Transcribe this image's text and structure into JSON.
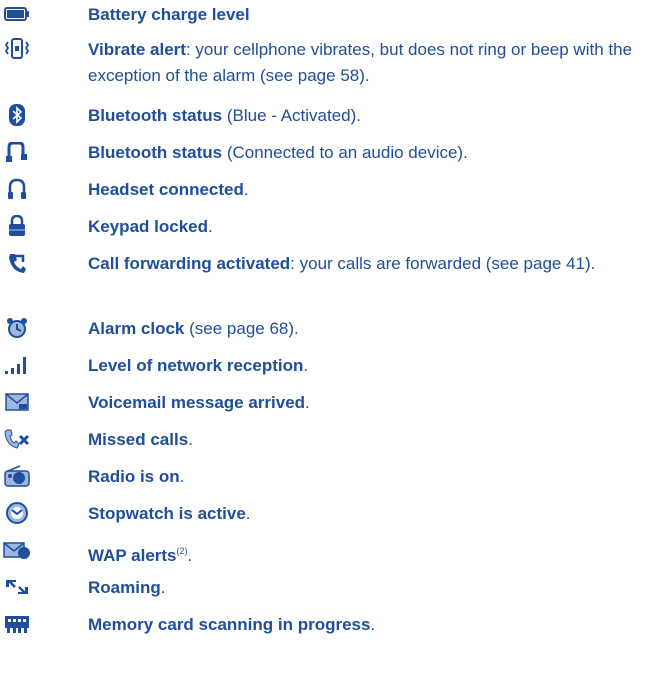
{
  "colors": {
    "text": "#1f4e9c",
    "icon": "#1f4e9c",
    "icon_light": "#9db8df"
  },
  "items": [
    {
      "icon": "battery-icon",
      "title": "Battery charge level",
      "desc": ""
    },
    {
      "icon": "vibrate-icon",
      "title": "Vibrate alert",
      "desc": ": your cellphone vibrates, but does not ring or beep with the exception of the alarm (see page 58)."
    },
    {
      "icon": "bluetooth-icon",
      "title": "Bluetooth status",
      "desc": " (Blue - Activated)."
    },
    {
      "icon": "bluetooth-audio-icon",
      "title": "Bluetooth status",
      "desc": " (Connected to an audio device)."
    },
    {
      "icon": "headset-icon",
      "title": "Headset connected",
      "desc": "."
    },
    {
      "icon": "lock-icon",
      "title": "Keypad locked",
      "desc": "."
    },
    {
      "icon": "call-forward-icon",
      "title": "Call forwarding activated",
      "desc": ": your calls are forwarded (see page 41)."
    },
    {
      "icon": "alarm-clock-icon",
      "title": "Alarm clock",
      "desc": " (see page 68)."
    },
    {
      "icon": "signal-icon",
      "title": "Level of network reception",
      "desc": "."
    },
    {
      "icon": "voicemail-icon",
      "title": "Voicemail message arrived",
      "desc": "."
    },
    {
      "icon": "missed-call-icon",
      "title": "Missed calls",
      "desc": "."
    },
    {
      "icon": "radio-icon",
      "title": "Radio is on",
      "desc": "."
    },
    {
      "icon": "stopwatch-icon",
      "title": "Stopwatch is active",
      "desc": "."
    },
    {
      "icon": "wap-alert-icon",
      "title": "WAP alerts",
      "desc": ".",
      "sup": "(2)"
    },
    {
      "icon": "roaming-icon",
      "title": "Roaming",
      "desc": "."
    },
    {
      "icon": "memory-card-icon",
      "title": "Memory card scanning in progress",
      "desc": "."
    }
  ]
}
